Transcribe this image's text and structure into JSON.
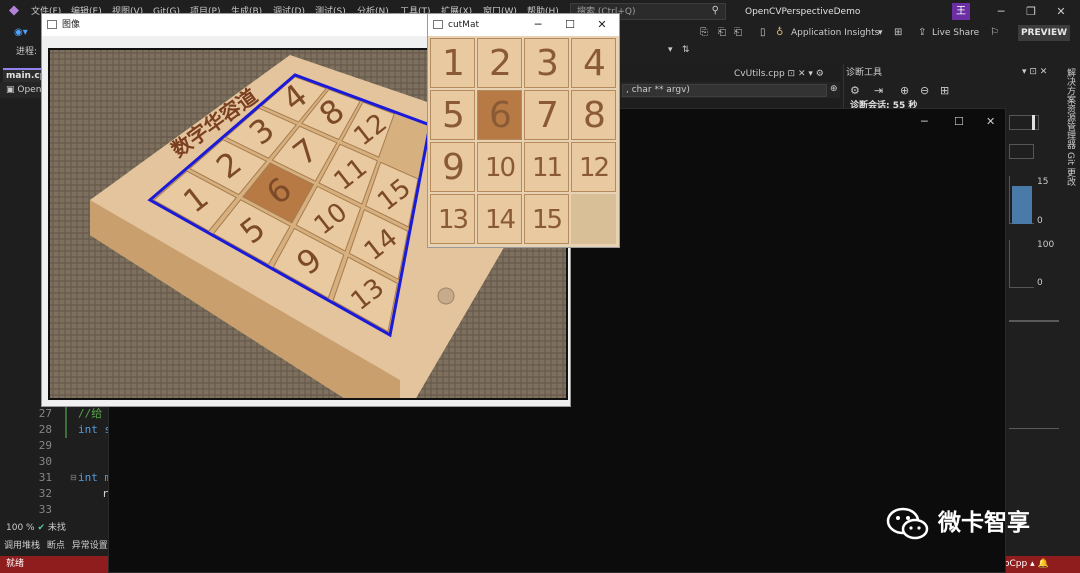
{
  "menubar": {
    "items": [
      "文件(F)",
      "编辑(E)",
      "视图(V)",
      "Git(G)",
      "项目(P)",
      "生成(B)",
      "调试(D)",
      "测试(S)",
      "分析(N)",
      "工具(T)",
      "扩展(X)",
      "窗口(W)",
      "帮助(H)"
    ],
    "search_placeholder": "搜索 (Ctrl+Q)",
    "solution_name": "OpenCVPerspectiveDemo",
    "avatar": "王"
  },
  "toolbar": {
    "app_insights": "Application Insights",
    "live_share": "Live Share",
    "preview": "PREVIEW",
    "progress_label": "进程:"
  },
  "editor": {
    "tabs": [
      "main.cpp",
      "CvUtils.cpp"
    ],
    "nav_left": "Open",
    "nav_right": ", char ** argv)",
    "lines": [
      {
        "num": "27",
        "code": "//给"
      },
      {
        "num": "28",
        "code": "int s"
      },
      {
        "num": "29",
        "code": ""
      },
      {
        "num": "30",
        "code": ""
      },
      {
        "num": "31",
        "code": "int m"
      },
      {
        "num": "32",
        "code": "r"
      },
      {
        "num": "33",
        "code": ""
      }
    ],
    "zoom": "100 %",
    "status_msg": "未找",
    "bottom_tabs": [
      "调用堆栈",
      "断点",
      "异常设置"
    ]
  },
  "diagnostics": {
    "title": "诊断工具",
    "session": "诊断会话: 55 秒",
    "memory_max": "15",
    "memory_min": "0",
    "cpu_max": "100",
    "cpu_min": "0"
  },
  "side_rail": [
    "解决方案资源管理器",
    "Git 更改"
  ],
  "status_bar": {
    "left": "就绪",
    "right": "oCpp"
  },
  "window_image": {
    "title": "图像"
  },
  "window_cutmat": {
    "title": "cutMat",
    "tiles": [
      "1",
      "2",
      "3",
      "4",
      "5",
      "6",
      "7",
      "8",
      "9",
      "10",
      "11",
      "12",
      "13",
      "14",
      "15"
    ]
  },
  "puzzle": {
    "brand": "数字华容道",
    "numbers": [
      "1",
      "2",
      "3",
      "4",
      "5",
      "6",
      "7",
      "8",
      "9",
      "10",
      "11",
      "12",
      "13",
      "14",
      "15"
    ]
  },
  "watermark": {
    "text": "微卡智享"
  },
  "colors": {
    "status_bar": "#8f1d1d",
    "detection_box": "#1a1ad8",
    "wood_light": "#e8c9a0",
    "wood_dark": "#c08a50",
    "highlight_tile": "#b77a45"
  }
}
